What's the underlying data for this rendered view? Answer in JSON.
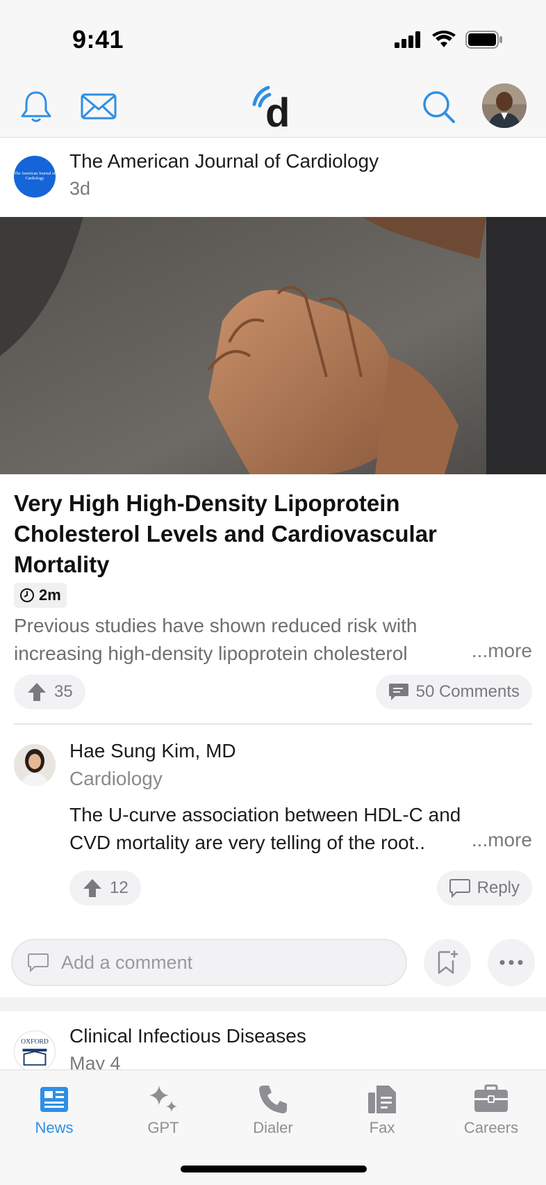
{
  "status_bar": {
    "time": "9:41"
  },
  "header": {
    "logo_letter": "d"
  },
  "post": {
    "source_name": "The American Journal of Cardiology",
    "source_time": "3d",
    "logo_text": "The American Journal of Cardiology",
    "title": "Very High High-Density Lipoprotein Cholesterol Levels and Cardiovascular Mortality",
    "read_time": "2m",
    "summary_line1": "Previous studies have shown reduced risk with",
    "summary_line2": "increasing high-density lipoprotein cholesterol",
    "more": "...more",
    "upvotes": "35",
    "comments_label": "50 Comments"
  },
  "comment": {
    "author": "Hae Sung Kim, MD",
    "specialty": "Cardiology",
    "text_line1": "The U-curve association between HDL-C and",
    "text_line2": "CVD mortality are very telling of the root..",
    "more": "...more",
    "upvotes": "12",
    "reply_label": "Reply"
  },
  "add_comment": {
    "placeholder": "Add a comment"
  },
  "next_post": {
    "source_name": "Clinical Infectious Diseases",
    "source_time": "May 4",
    "logo_text": "OXFORD"
  },
  "tabs": [
    {
      "label": "News",
      "icon": "newspaper-icon",
      "active": true
    },
    {
      "label": "GPT",
      "icon": "sparkles-icon",
      "active": false
    },
    {
      "label": "Dialer",
      "icon": "phone-icon",
      "active": false
    },
    {
      "label": "Fax",
      "icon": "fax-icon",
      "active": false
    },
    {
      "label": "Careers",
      "icon": "briefcase-icon",
      "active": false
    }
  ],
  "colors": {
    "accent": "#2e8fe6",
    "journal_logo_bg": "#1565d8",
    "muted": "#7a7a7e"
  }
}
